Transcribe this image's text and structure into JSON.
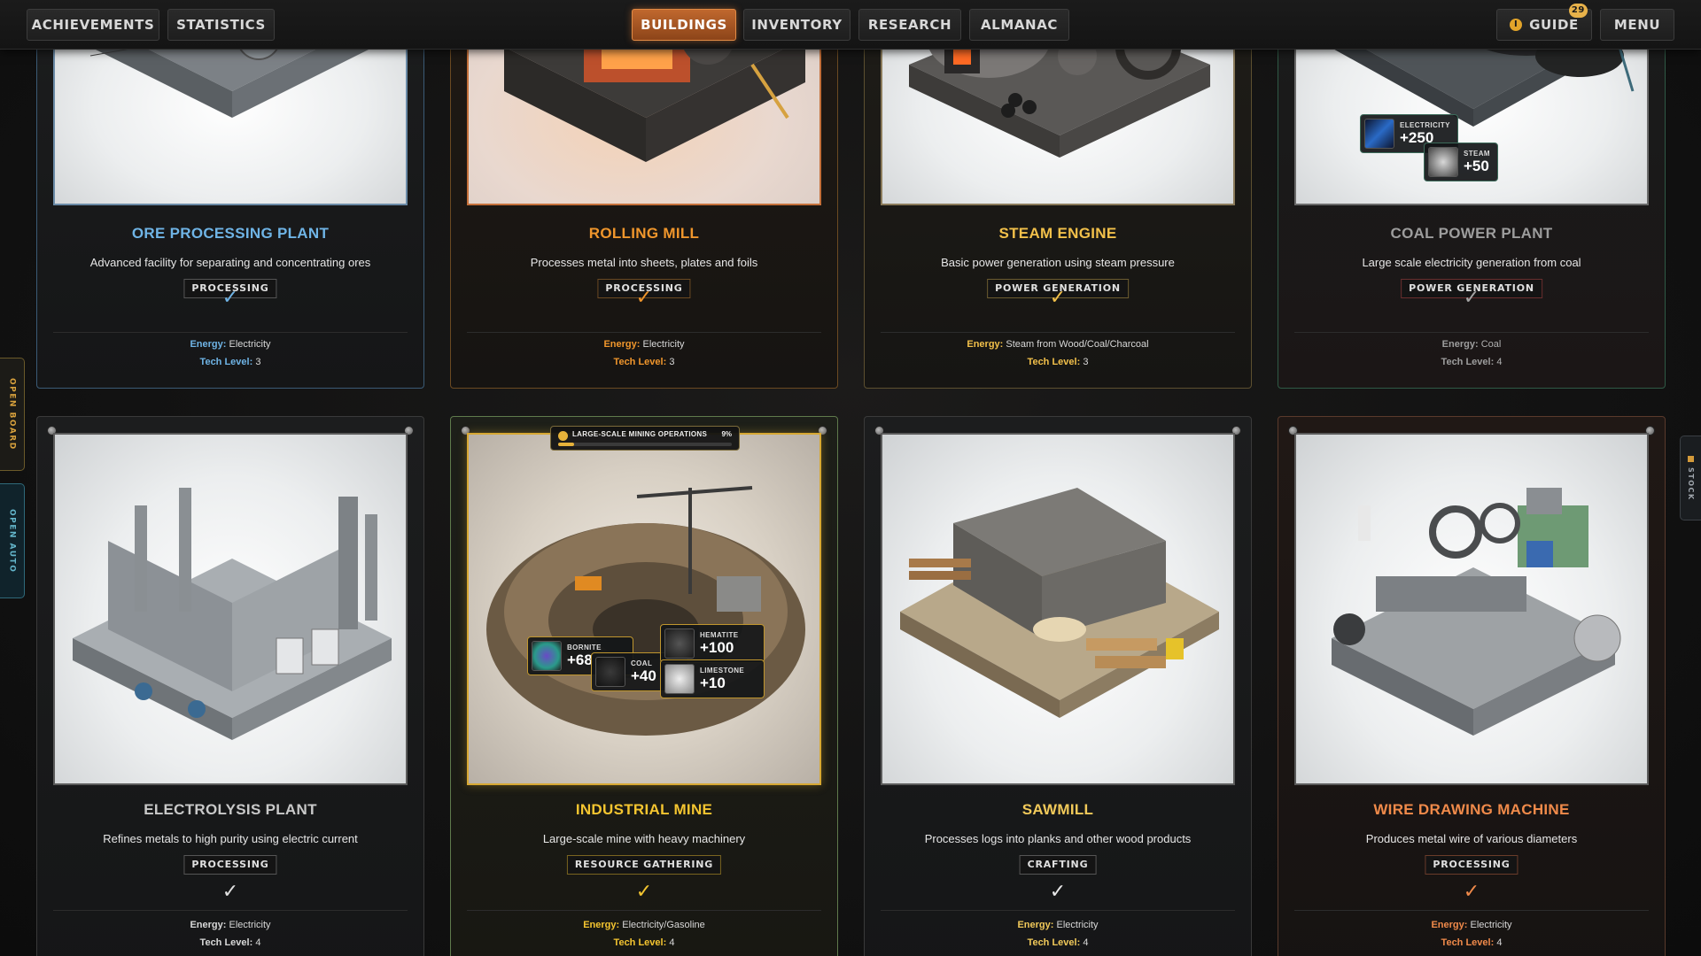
{
  "nav": {
    "left": [
      {
        "label": "ACHIEVEMENTS"
      },
      {
        "label": "STATISTICS"
      }
    ],
    "center": [
      {
        "label": "BUILDINGS",
        "active": true
      },
      {
        "label": "INVENTORY"
      },
      {
        "label": "RESEARCH"
      },
      {
        "label": "ALMANAC"
      }
    ],
    "guide": {
      "label": "GUIDE",
      "badge": "29",
      "icon": "info-icon"
    },
    "menu": {
      "label": "MENU"
    }
  },
  "side_tabs": {
    "board": "OPEN BOARD",
    "auto": "OPEN AUTO",
    "stock": "STOCK"
  },
  "cards": [
    {
      "title": "ORE PROCESSING PLANT",
      "desc": "Advanced facility for separating and concentrating ores",
      "tag": "PROCESSING",
      "check": "✓",
      "energy_label": "Energy:",
      "energy": "Electricity",
      "tech_label": "Tech Level:",
      "tech": "3"
    },
    {
      "title": "ROLLING MILL",
      "desc": "Processes metal into sheets, plates and foils",
      "tag": "PROCESSING",
      "check": "✓",
      "energy_label": "Energy:",
      "energy": "Electricity",
      "tech_label": "Tech Level:",
      "tech": "3"
    },
    {
      "title": "STEAM ENGINE",
      "desc": "Basic power generation using steam pressure",
      "tag": "POWER GENERATION",
      "check": "✓",
      "energy_label": "Energy:",
      "energy": "Steam from Wood/Coal/Charcoal",
      "tech_label": "Tech Level:",
      "tech": "3"
    },
    {
      "title": "COAL POWER PLANT",
      "desc": "Large scale electricity generation from coal",
      "tag": "POWER GENERATION",
      "check": "✓",
      "energy_label": "Energy:",
      "energy": "Coal",
      "tech_label": "Tech Level:",
      "tech": "4"
    },
    {
      "title": "ELECTROLYSIS PLANT",
      "desc": "Refines metals to high purity using electric current",
      "tag": "PROCESSING",
      "check": "✓",
      "energy_label": "Energy:",
      "energy": "Electricity",
      "tech_label": "Tech Level:",
      "tech": "4"
    },
    {
      "title": "INDUSTRIAL MINE",
      "desc": "Large-scale mine with heavy machinery",
      "tag": "RESOURCE GATHERING",
      "check": "✓",
      "energy_label": "Energy:",
      "energy": "Electricity/Gasoline",
      "tech_label": "Tech Level:",
      "tech": "4"
    },
    {
      "title": "SAWMILL",
      "desc": "Processes logs into planks and other wood products",
      "tag": "CRAFTING",
      "check": "✓",
      "energy_label": "Energy:",
      "energy": "Electricity",
      "tech_label": "Tech Level:",
      "tech": "4"
    },
    {
      "title": "WIRE DRAWING MACHINE",
      "desc": "Produces metal wire of various diameters",
      "tag": "PROCESSING",
      "check": "✓",
      "energy_label": "Energy:",
      "energy": "Electricity",
      "tech_label": "Tech Level:",
      "tech": "4"
    }
  ],
  "coal_plant_outputs": [
    {
      "label": "ELECTRICITY",
      "value": "+250"
    },
    {
      "label": "STEAM",
      "value": "+50"
    }
  ],
  "mine_outputs": [
    {
      "label": "BORNITE",
      "value": "+68"
    },
    {
      "label": "COAL",
      "value": "+40"
    },
    {
      "label": "HEMATITE",
      "value": "+100"
    },
    {
      "label": "LIMESTONE",
      "value": "+10"
    }
  ],
  "mine_progress": {
    "label": "LARGE-SCALE MINING OPERATIONS",
    "percent_text": "9%",
    "percent": 9
  },
  "colors": {
    "accent": "#c0682e",
    "blue": "#6fb4e6",
    "gold": "#f2c04a",
    "orange": "#f0962c"
  }
}
